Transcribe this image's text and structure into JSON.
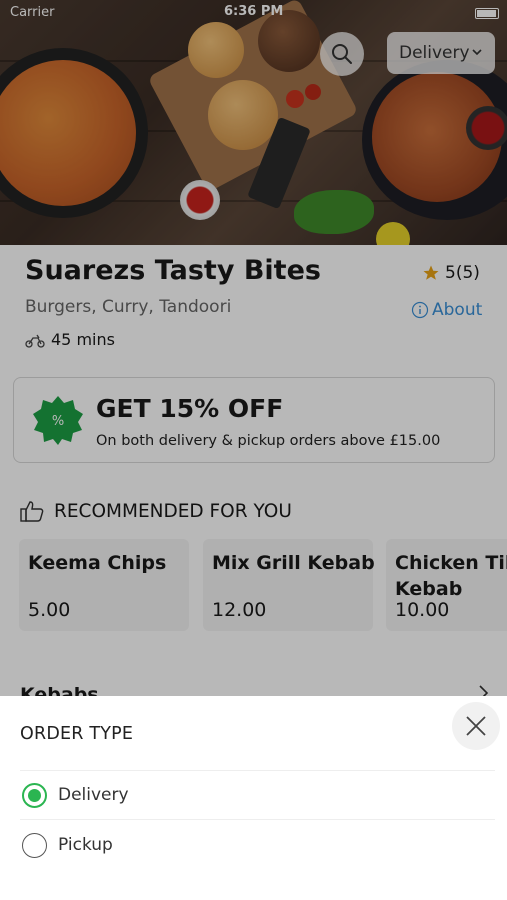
{
  "status_bar": {
    "carrier": "Carrier",
    "time": "6:36 PM"
  },
  "header": {
    "order_type_button": "Delivery"
  },
  "restaurant": {
    "name": "Suarezs Tasty Bites",
    "rating": "5(5)",
    "cuisines": "Burgers, Curry, Tandoori",
    "about_label": "About",
    "delivery_time": "45 mins"
  },
  "promo": {
    "title": "GET 15% OFF",
    "subtitle": "On both delivery & pickup orders above £15.00"
  },
  "recommended": {
    "title": "RECOMMENDED FOR YOU",
    "items": [
      {
        "name": "Keema Chips",
        "price": "5.00"
      },
      {
        "name": "Mix Grill Kebab",
        "price": "12.00"
      },
      {
        "name": "Chicken Tikka Kebab",
        "name_line1": "Chicken Tik",
        "name_line2": "Kebab",
        "price": "10.00"
      }
    ]
  },
  "category": {
    "label": "Kebabs"
  },
  "order_sheet": {
    "title": "ORDER TYPE",
    "options": [
      {
        "label": "Delivery",
        "selected": true
      },
      {
        "label": "Pickup",
        "selected": false
      }
    ]
  },
  "colors": {
    "accent_green": "#2bb551",
    "link_blue": "#3a8fd6",
    "star": "#e8a317"
  }
}
